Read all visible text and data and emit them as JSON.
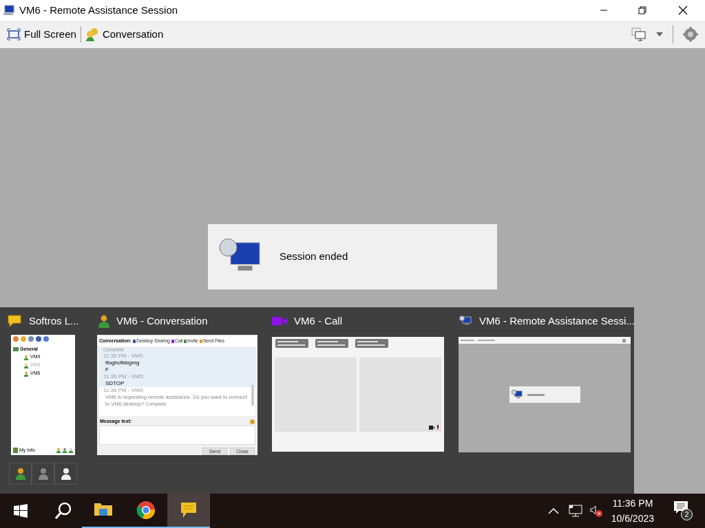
{
  "window": {
    "title": "VM6 - Remote Assistance Session"
  },
  "toolbar": {
    "buttons": [
      {
        "kind": "fullscreen",
        "label": "Full Screen"
      },
      {
        "kind": "conversation",
        "label": "Conversation"
      }
    ]
  },
  "notice": {
    "text": "Session ended"
  },
  "task_switcher": {
    "items": [
      {
        "kind": "contacts",
        "title": "Softros L...",
        "group": "General",
        "contacts": [
          {
            "name": "VM4",
            "online": true
          },
          {
            "name": "VM5",
            "online": false
          },
          {
            "name": "VM6",
            "online": true
          }
        ],
        "footer": "My Info"
      },
      {
        "kind": "chat",
        "title": "VM6 - Conversation",
        "toolbar_label": "Conversation:",
        "tools": [
          {
            "kind": "share",
            "label": "Desktop Sharing"
          },
          {
            "kind": "call",
            "label": "Call"
          },
          {
            "kind": "invite",
            "label": "Invite"
          },
          {
            "kind": "files",
            "label": "Send Files"
          }
        ],
        "messages": [
          {
            "kind": "status",
            "text": "Complete",
            "highlighted": true
          },
          {
            "kind": "message",
            "header": "11:35 PM - VM5:",
            "lines": [
              "tfughcfkkigmg",
              "F"
            ],
            "highlighted": true
          },
          {
            "kind": "message",
            "header": "11:36 PM - VM5:",
            "lines": [
              "SDTOP"
            ],
            "highlighted": true
          },
          {
            "kind": "request",
            "header": "11:36 PM - VM6:",
            "text": "VM6 is requesting remote assistance. Do you want to connect to VM6 desktop?",
            "status": "Complete",
            "highlighted": false
          }
        ],
        "message_label": "Message text:",
        "buttons": [
          "Send",
          "Close"
        ]
      },
      {
        "kind": "call",
        "title": "VM6 - Call"
      },
      {
        "kind": "session",
        "title": "VM6 - Remote Assistance Sessi..."
      }
    ],
    "status_buttons": [
      {
        "kind": "online"
      },
      {
        "kind": "away"
      },
      {
        "kind": "offline"
      }
    ]
  },
  "taskbar": {
    "apps": [
      {
        "kind": "explorer",
        "selected": false
      },
      {
        "kind": "chrome",
        "selected": false
      },
      {
        "kind": "softros",
        "selected": true
      }
    ],
    "time": "11:36 PM",
    "date": "10/6/2023",
    "notifications": "2"
  }
}
